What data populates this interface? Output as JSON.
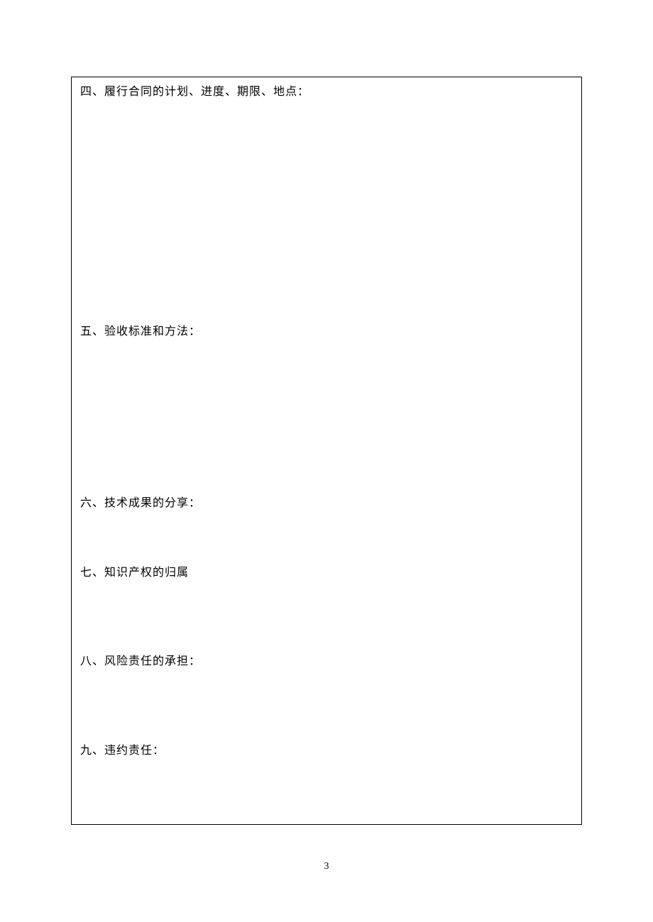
{
  "sections": {
    "s4": "四、履行合同的计划、进度、期限、地点：",
    "s5": "五、验收标准和方法：",
    "s6": "六、技术成果的分享：",
    "s7": "七、知识产权的归属",
    "s8": "八、风险责任的承担：",
    "s9": "九、违约责任："
  },
  "pageNumber": "3"
}
